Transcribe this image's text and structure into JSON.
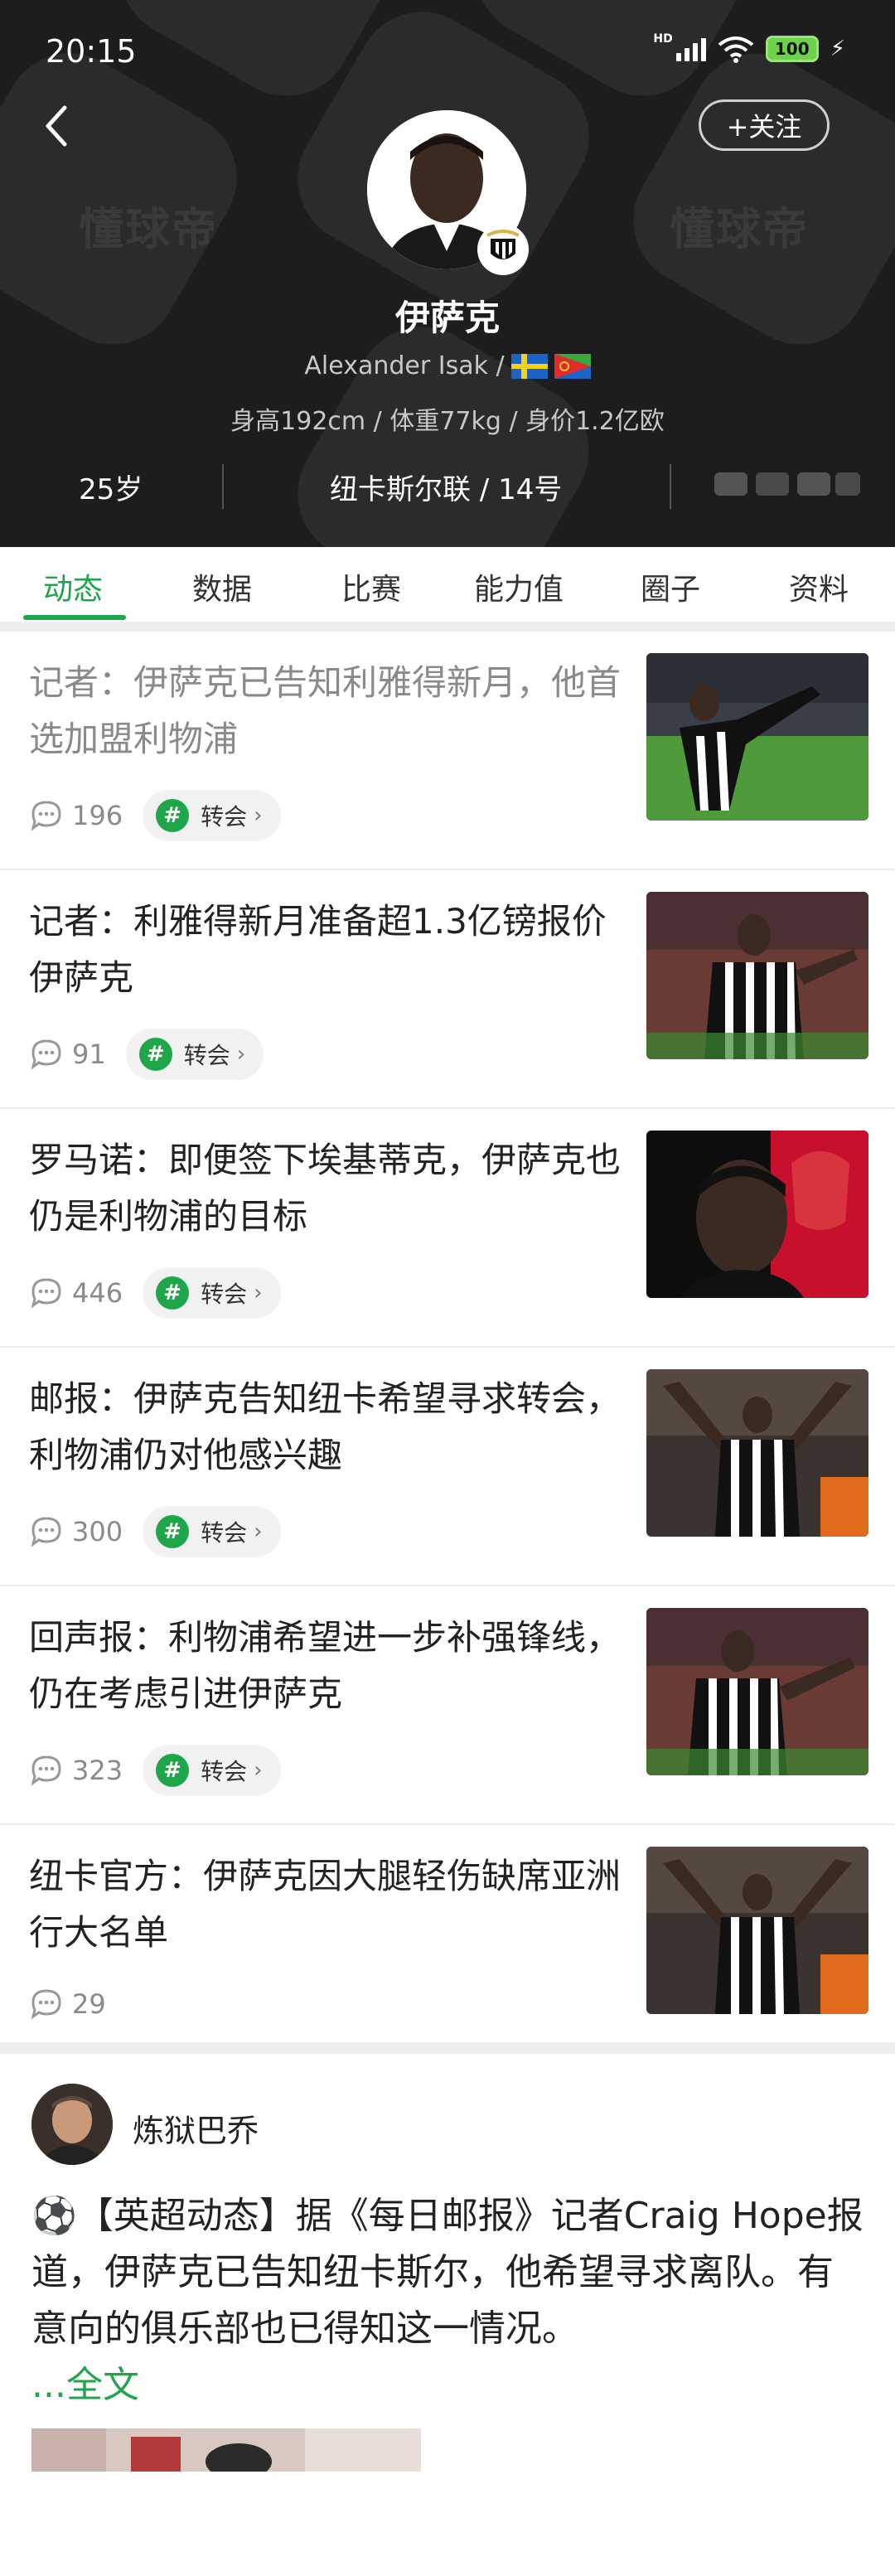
{
  "status_bar": {
    "time": "20:15",
    "hd_label": "HD",
    "battery": "100"
  },
  "header": {
    "follow_label": "+关注",
    "watermark": "懂球帝",
    "player_name": "伊萨克",
    "english_name": "Alexander Isak /",
    "info_line": "身高192cm / 体重77kg / 身价1.2亿欧",
    "age": "25岁",
    "club_number": "纽卡斯尔联 / 14号"
  },
  "tabs": [
    "动态",
    "数据",
    "比赛",
    "能力值",
    "圈子",
    "资料"
  ],
  "active_tab": 0,
  "news": [
    {
      "title": "记者：伊萨克已告知利雅得新月，他首选加盟利物浦",
      "comments": "196",
      "tag": "转会",
      "read": true
    },
    {
      "title": "记者：利雅得新月准备超1.3亿镑报价伊萨克",
      "comments": "91",
      "tag": "转会",
      "read": false
    },
    {
      "title": "罗马诺：即便签下埃基蒂克，伊萨克也仍是利物浦的目标",
      "comments": "446",
      "tag": "转会",
      "read": false
    },
    {
      "title": "邮报：伊萨克告知纽卡希望寻求转会，利物浦仍对他感兴趣",
      "comments": "300",
      "tag": "转会",
      "read": false
    },
    {
      "title": "回声报：利物浦希望进一步补强锋线，仍在考虑引进伊萨克",
      "comments": "323",
      "tag": "转会",
      "read": false
    },
    {
      "title": "纽卡官方：伊萨克因大腿轻伤缺席亚洲行大名单",
      "comments": "29",
      "tag": "",
      "read": false
    }
  ],
  "post": {
    "username": "炼狱巴乔",
    "emoji": "⚽",
    "text": "【英超动态】据《每日邮报》记者Craig Hope报道，伊萨克已告知纽卡斯尔，他希望寻求离队。有意向的俱乐部也已得知这一情况。",
    "more_label": "...全文"
  },
  "colors": {
    "accent": "#1fa54a",
    "header_bg": "#1d1d1d"
  },
  "icons": [
    "back-arrow-icon",
    "signal-icon",
    "wifi-icon",
    "battery-icon",
    "comment-icon",
    "hashtag-icon",
    "chevron-right-icon",
    "sweden-flag-icon",
    "eritrea-flag-icon"
  ]
}
